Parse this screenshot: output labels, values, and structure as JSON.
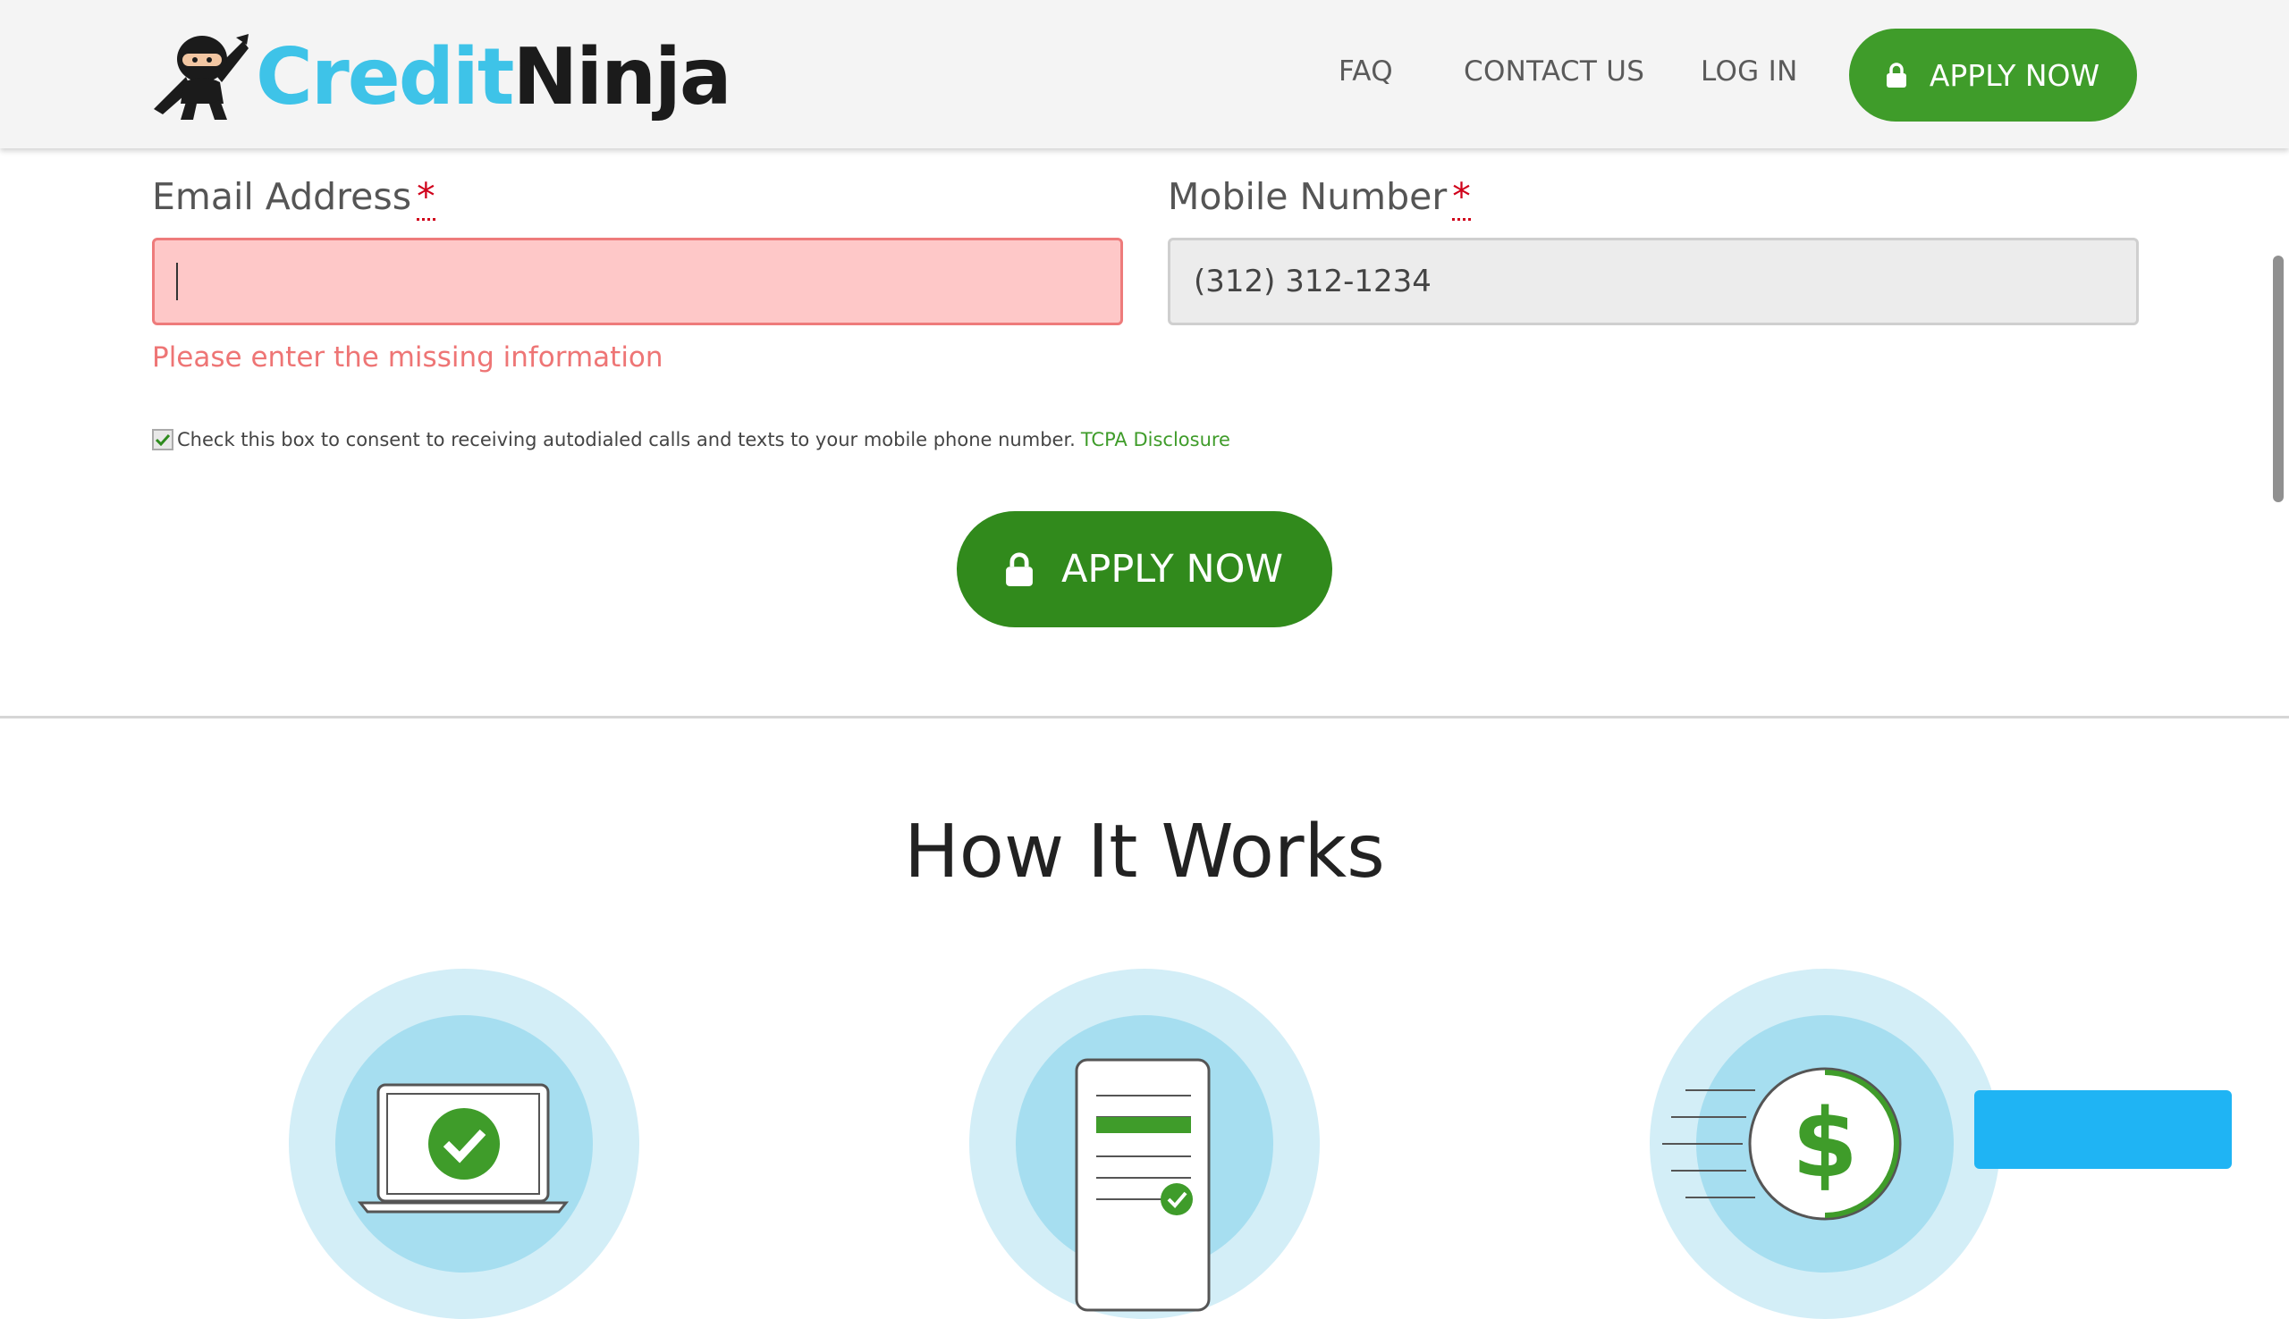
{
  "header": {
    "logo_part1": "Credit",
    "logo_part2": "Ninja",
    "nav": [
      {
        "label": "FAQ"
      },
      {
        "label": "CONTACT US"
      },
      {
        "label": "LOG IN"
      }
    ],
    "apply_label": "APPLY NOW"
  },
  "form": {
    "email": {
      "label": "Email Address",
      "required_mark": "*",
      "value": "",
      "error": "Please enter the missing information"
    },
    "mobile": {
      "label": "Mobile Number",
      "required_mark": "*",
      "value": "(312) 312-1234"
    },
    "consent": {
      "checked": true,
      "text": "Check this box to consent to receiving autodialed calls and texts to your mobile phone number.",
      "link": "TCPA Disclosure"
    },
    "apply_label": "APPLY NOW"
  },
  "how_it_works": {
    "title": "How It Works",
    "steps": [
      {
        "icon": "laptop-check-icon"
      },
      {
        "icon": "document-check-icon"
      },
      {
        "icon": "dollar-coin-icon"
      }
    ]
  },
  "colors": {
    "brand_blue": "#3ec3e8",
    "brand_green": "#3f9c2a",
    "apply_green": "#318a1c",
    "error_bg": "#fec8c8",
    "chat_blue": "#1fb4f4"
  }
}
